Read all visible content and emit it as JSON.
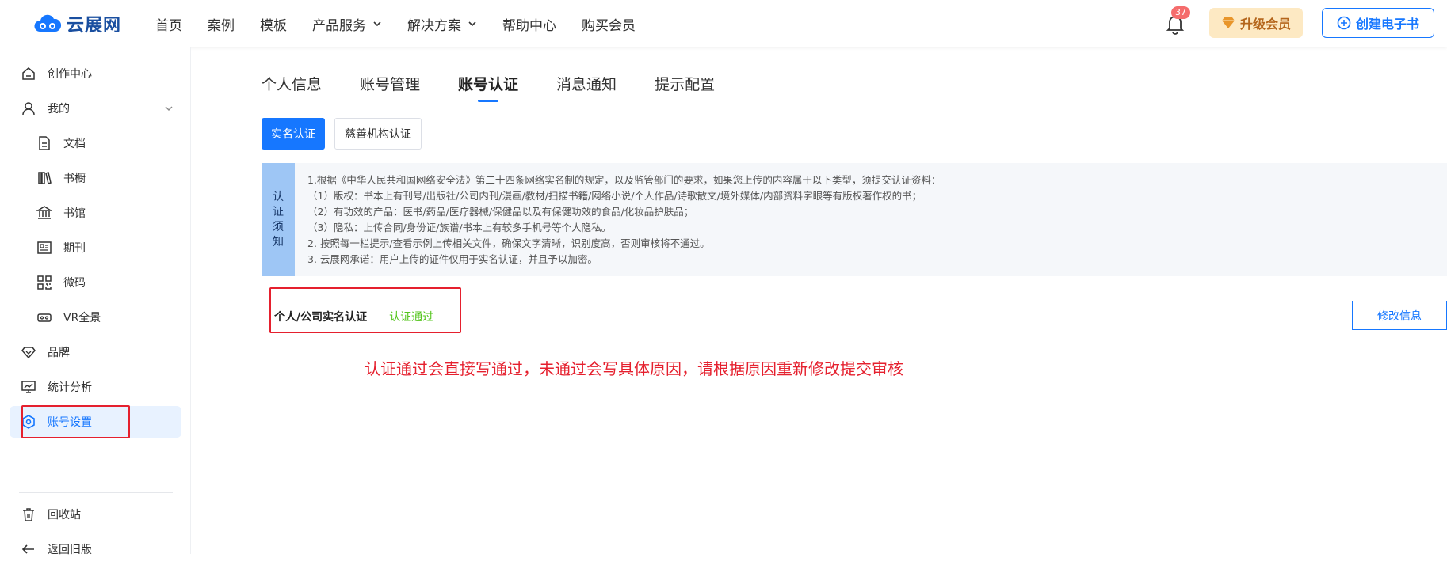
{
  "brand": {
    "name": "云展网",
    "color": "#1a4fa0"
  },
  "nav": [
    {
      "label": "首页",
      "dropdown": false
    },
    {
      "label": "案例",
      "dropdown": false
    },
    {
      "label": "模板",
      "dropdown": false
    },
    {
      "label": "产品服务",
      "dropdown": true
    },
    {
      "label": "解决方案",
      "dropdown": true
    },
    {
      "label": "帮助中心",
      "dropdown": false
    },
    {
      "label": "购买会员",
      "dropdown": false
    }
  ],
  "header": {
    "notification_count": "37",
    "upgrade_label": "升级会员",
    "create_label": "创建电子书"
  },
  "sidebar": {
    "items": [
      {
        "label": "创作中心",
        "icon": "home-icon"
      },
      {
        "label": "我的",
        "icon": "user-icon"
      },
      {
        "label": "文档",
        "icon": "document-icon"
      },
      {
        "label": "书橱",
        "icon": "bookshelf-icon"
      },
      {
        "label": "书馆",
        "icon": "library-icon"
      },
      {
        "label": "期刊",
        "icon": "journal-icon"
      },
      {
        "label": "微码",
        "icon": "qrcode-icon"
      },
      {
        "label": "VR全景",
        "icon": "vr-icon"
      },
      {
        "label": "品牌",
        "icon": "diamond-icon"
      },
      {
        "label": "统计分析",
        "icon": "chart-icon"
      },
      {
        "label": "账号设置",
        "icon": "settings-icon"
      },
      {
        "label": "回收站",
        "icon": "trash-icon"
      },
      {
        "label": "返回旧版",
        "icon": "arrow-left-icon"
      }
    ]
  },
  "tabs": [
    "个人信息",
    "账号管理",
    "账号认证",
    "消息通知",
    "提示配置"
  ],
  "active_tab": "账号认证",
  "subtabs": [
    "实名认证",
    "慈善机构认证"
  ],
  "notice": {
    "label": "认证须知",
    "lines": [
      "1.根据《中华人民共和国网络安全法》第二十四条网络实名制的规定，以及监管部门的要求，如果您上传的内容属于以下类型，须提交认证资料：",
      "（1）版权：书本上有刊号/出版社/公司内刊/漫画/教材/扫描书籍/网络小说/个人作品/诗歌散文/境外媒体/内部资料字眼等有版权著作权的书；",
      "（2）有功效的产品：医书/药品/医疗器械/保健品以及有保健功效的食品/化妆品护肤品；",
      "（3）隐私：上传合同/身份证/族谱/书本上有较多手机号等个人隐私。",
      "2. 按照每一栏提示/查看示例上传相关文件，确保文字清晰，识别度高，否则审核将不通过。",
      "3. 云展网承诺：用户上传的证件仅用于实名认证，并且予以加密。"
    ]
  },
  "certification": {
    "label": "个人/公司实名认证",
    "status": "认证通过",
    "status_color": "#52c41a",
    "edit_label": "修改信息"
  },
  "annotation": "认证通过会直接写通过，未通过会写具体原因，请根据原因重新修改提交审核",
  "colors": {
    "accent": "#1677ff",
    "alert": "#e5202e"
  }
}
